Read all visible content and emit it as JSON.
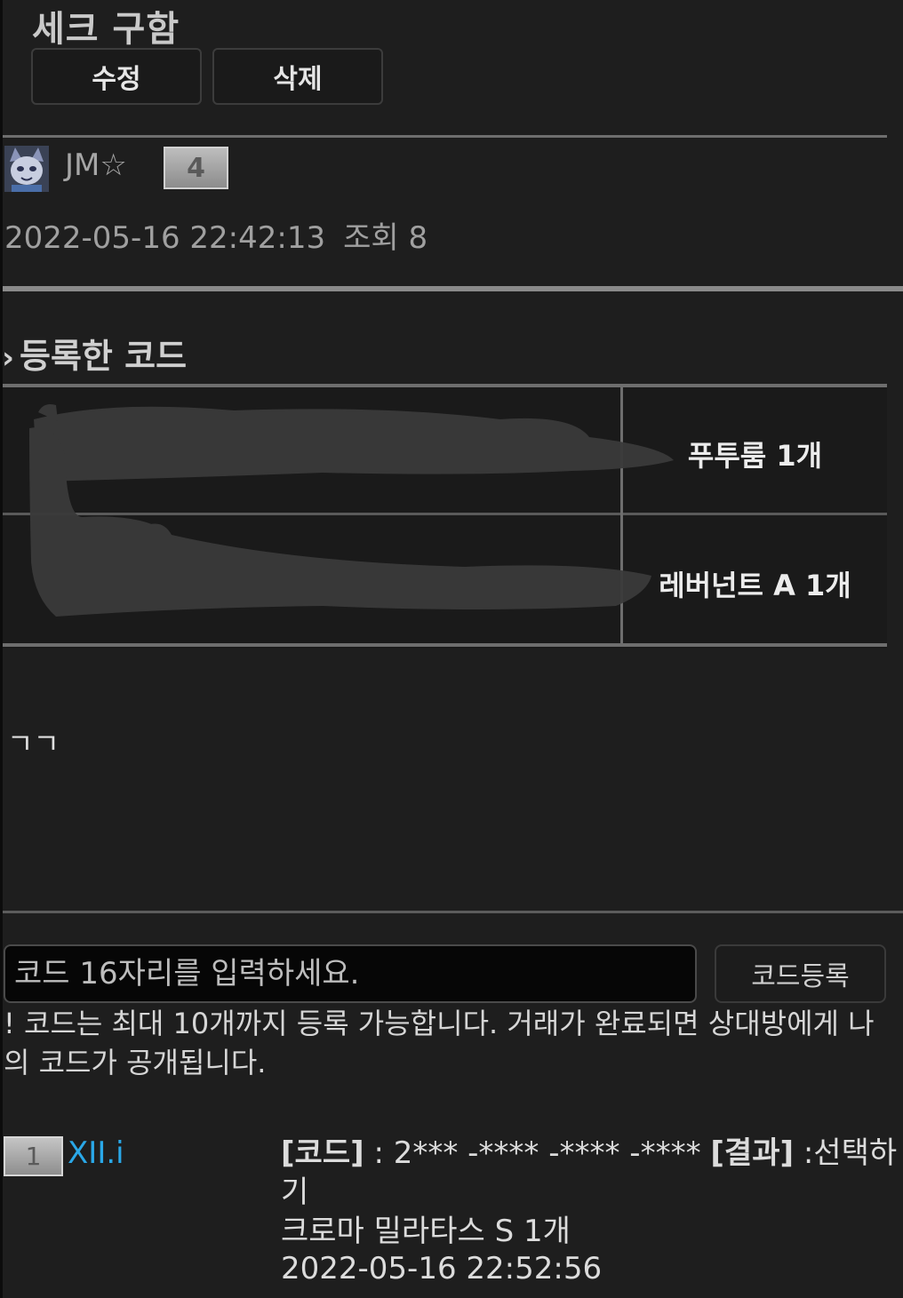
{
  "post": {
    "title": "세크 구함",
    "edit_label": "수정",
    "delete_label": "삭제",
    "author": "JM☆",
    "author_level": "4",
    "datetime": "2022-05-16 22:42:13",
    "views": "조회 8",
    "body": "ㄱㄱ"
  },
  "codes_section": {
    "chevron": "›",
    "heading": "등록한 코드",
    "rows": [
      {
        "code": "",
        "item": "푸투룸 1개"
      },
      {
        "code": "",
        "item": "레버넌트 A 1개"
      }
    ]
  },
  "code_form": {
    "placeholder": "코드 16자리를 입력하세요.",
    "submit_label": "코드등록",
    "notice": "! 코드는 최대 10개까지 등록 가능합니다. 거래가 완료되면 상대방에게 나의 코드가 공개됩니다."
  },
  "entries": [
    {
      "level": "1",
      "user": "XII.i",
      "code_label": "[코드]",
      "code_value": " : 2*** -**** -**** -****",
      "result_label": "[결과]",
      "result_value": " :선택하기",
      "item": "크로마 밀라타스 S 1개",
      "datetime": "2022-05-16 22:52:56"
    }
  ],
  "colors": {
    "background": "#1e1e1e",
    "link": "#2aa8e8"
  }
}
